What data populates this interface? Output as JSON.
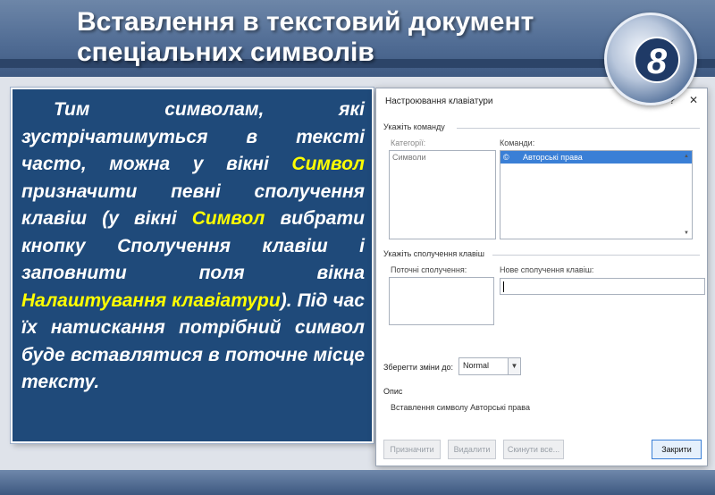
{
  "slide": {
    "title_line1": "Вставлення в текстовий документ",
    "title_line2": "спеціальних символів",
    "grade_badge": "8"
  },
  "text_panel": {
    "p1": "Тим символам, які зустрічатимуться в тексті часто, можна у вікні ",
    "hl1": "Символ",
    "p2": " призначити певні сполучення клавіш (у вікні ",
    "hl2": "Символ",
    "p3": " вибрати кнопку Сполучення клавіш і заповнити поля вікна ",
    "hl3": "Налаштування клавіатури",
    "p4": "). Під час їх натискання потрібний символ буде вставлятися в поточне місце тексту."
  },
  "dialog": {
    "title": "Настроювання клавіатури",
    "help_icon": "?",
    "close_icon": "✕",
    "section_command": "Укажіть команду",
    "categories_label": "Категорії:",
    "categories": [
      "Символи"
    ],
    "commands_label": "Команди:",
    "commands_symbol": "©",
    "commands": [
      "Авторські права"
    ],
    "section_keys": "Укажіть сполучення клавіш",
    "current_keys_label": "Поточні сполучення:",
    "new_keys_label": "Нове сполучення клавіш:",
    "new_keys_value": "",
    "save_in_label": "Зберегти зміни до:",
    "save_in_value": "Normal",
    "description_label": "Опис",
    "description_text": "Вставлення символу Авторські права",
    "buttons": {
      "assign": "Призначити",
      "remove": "Видалити",
      "reset": "Скинути все...",
      "close": "Закрити"
    }
  },
  "colors": {
    "panel_bg": "#1f4a7a",
    "highlight": "#ffff00",
    "selection": "#3a7fd6"
  }
}
